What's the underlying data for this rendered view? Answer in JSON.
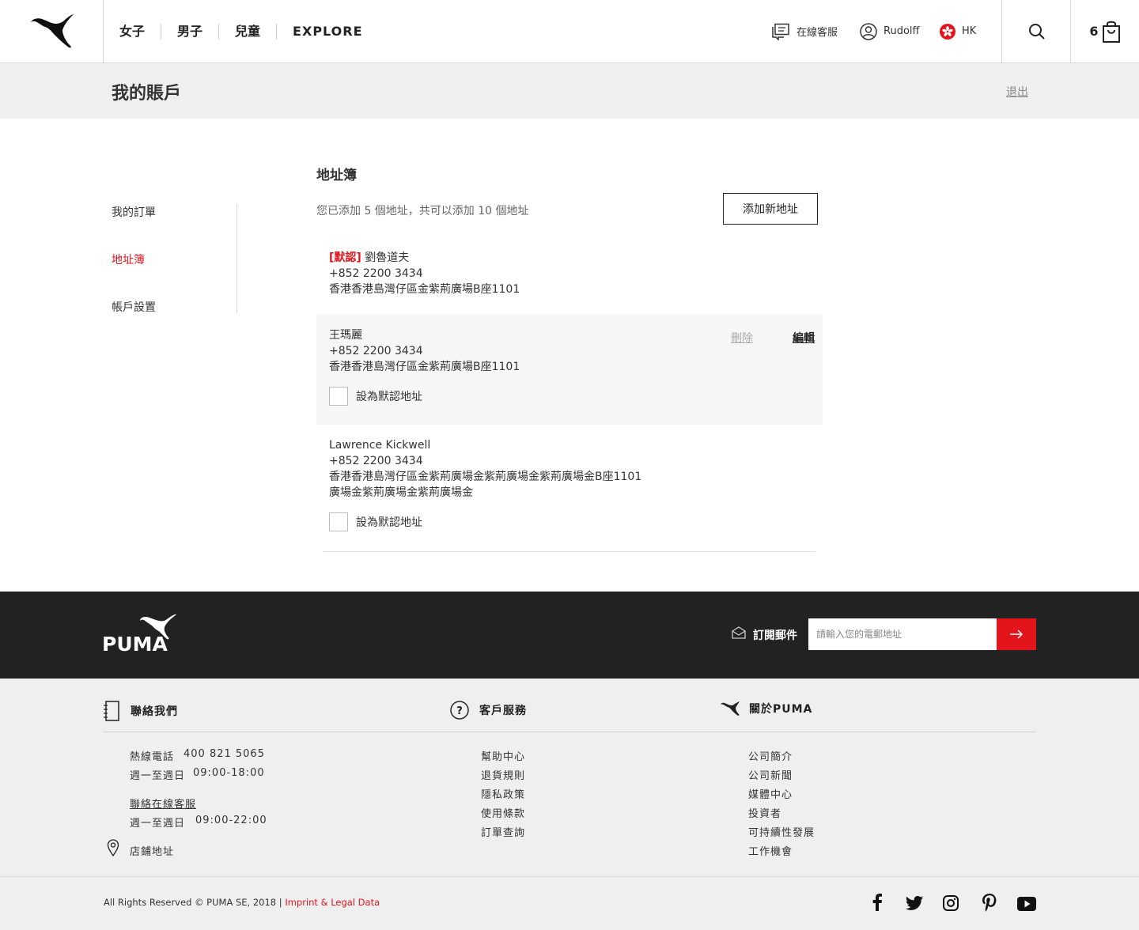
{
  "header": {
    "nav": [
      "女子",
      "男子",
      "兒童",
      "EXPLORE"
    ],
    "service_label": "在線客服",
    "user_label": "Rudolff",
    "region_label": "HK",
    "cart_count": "6"
  },
  "account": {
    "title": "我的賬戶",
    "logout_label": "退出"
  },
  "sidebar": {
    "items": [
      {
        "label": "我的訂單"
      },
      {
        "label": "地址簿"
      },
      {
        "label": "帳戶設置"
      }
    ]
  },
  "address_book": {
    "title": "地址簿",
    "count_text": "您已添加 5 個地址，共可以添加 10 個地址",
    "add_label": "添加新地址",
    "default_tag": "[默認]",
    "delete_label": "刪除",
    "edit_label": "編輯",
    "set_default_label": "設為默認地址",
    "addresses": [
      {
        "name": "劉魯道夫",
        "phone": "+852 2200 3434",
        "address": "香港香港島灣仔區金紫荊廣場B座1101"
      },
      {
        "name": "王瑪麗",
        "phone": "+852 2200 3434",
        "address": "香港香港島灣仔區金紫荊廣場B座1101"
      },
      {
        "name": "Lawrence Kickwell",
        "phone": "+852 2200 3434",
        "address": "香港香港島灣仔區金紫荊廣場金紫荊廣場金紫荊廣場金B座1101",
        "address_line2": "廣場金紫荊廣場金紫荊廣場金"
      }
    ]
  },
  "footer": {
    "brand": "PUMA",
    "subscribe_label": "訂閱郵件",
    "subscribe_placeholder": "請輸入您的電郵地址",
    "contact": {
      "title": "聯絡我們",
      "hotline_label": "熱線電話",
      "hotline": "400 821 5065",
      "hours1_label": "週一至週日",
      "hours1": "09:00-18:00",
      "online_service": "聯絡在線客服",
      "hours2_label": "週一至週日",
      "hours2": "09:00-22:00",
      "stores": "店鋪地址"
    },
    "service": {
      "title": "客戶服務",
      "links": [
        "幫助中心",
        "退貨規則",
        "隱私政策",
        "使用條款",
        "訂單查詢"
      ]
    },
    "about": {
      "title": "關於PUMA",
      "links": [
        "公司簡介",
        "公司新聞",
        "媒體中心",
        "投資者",
        "可持續性發展",
        "工作機會"
      ]
    },
    "copyright": "All Rights Reserved © PUMA SE, 2018 |",
    "imprint": "Imprint & Legal Data"
  },
  "colors": {
    "accent": "#e4141c",
    "footer_dark": "#222222",
    "footer_light": "#efefef"
  }
}
